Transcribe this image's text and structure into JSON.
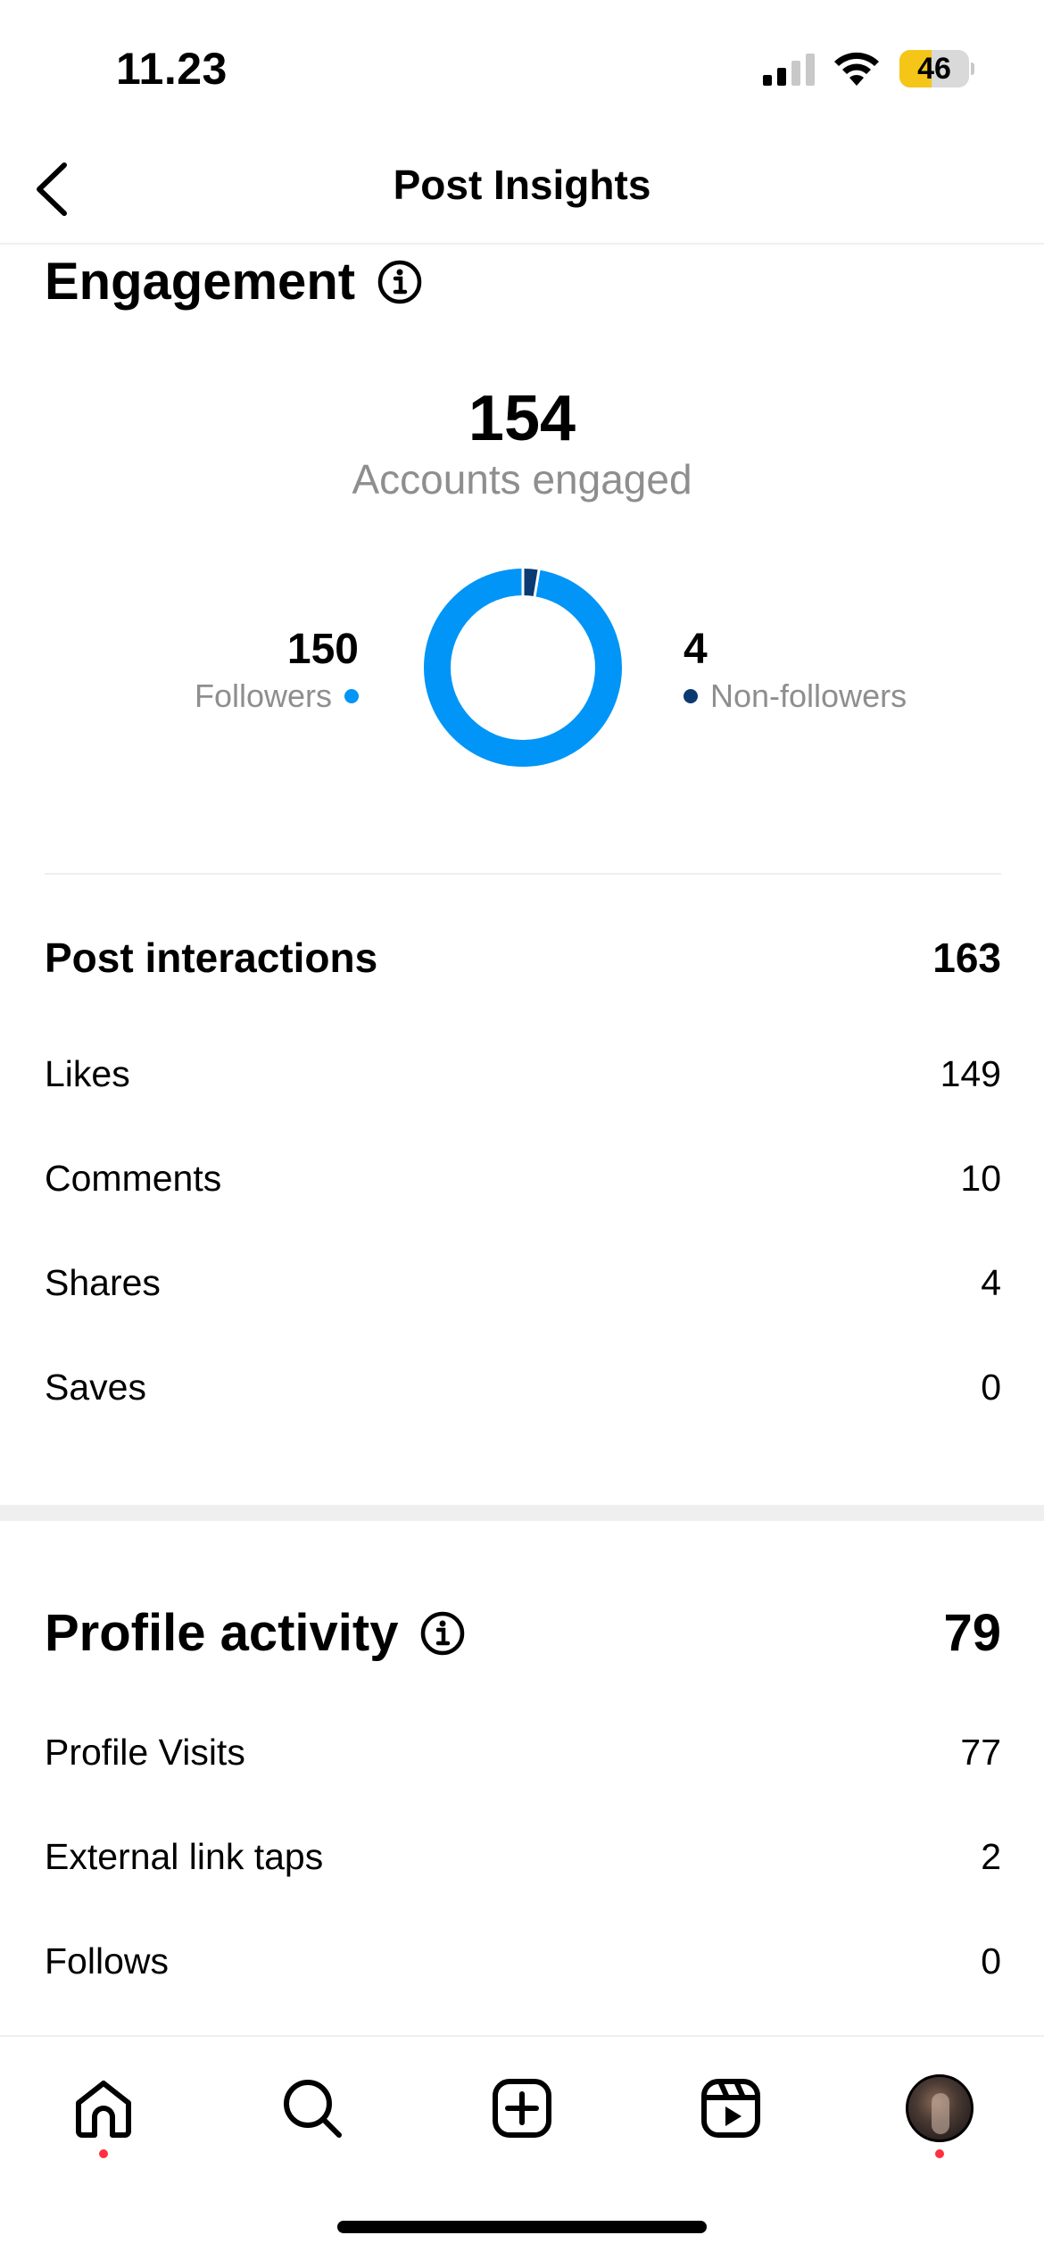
{
  "status_bar": {
    "time": "11.23",
    "battery_level": 46,
    "battery_text": "46",
    "battery_color": "#f5c518"
  },
  "header": {
    "back_icon": "chevron-left-icon",
    "title": "Post Insights"
  },
  "engagement": {
    "title": "Engagement",
    "info_icon": "info-icon",
    "accounts_engaged_value": "154",
    "accounts_engaged_label": "Accounts engaged",
    "followers_value": "150",
    "followers_label": "Followers",
    "non_followers_value": "4",
    "non_followers_label": "Non-followers",
    "followers_color": "#0095f6",
    "non_followers_color": "#0b3a73"
  },
  "post_interactions": {
    "title": "Post interactions",
    "total": "163",
    "rows": [
      {
        "label": "Likes",
        "value": "149"
      },
      {
        "label": "Comments",
        "value": "10"
      },
      {
        "label": "Shares",
        "value": "4"
      },
      {
        "label": "Saves",
        "value": "0"
      }
    ]
  },
  "profile_activity": {
    "title": "Profile activity",
    "info_icon": "info-icon",
    "total": "79",
    "rows": [
      {
        "label": "Profile Visits",
        "value": "77"
      },
      {
        "label": "External link taps",
        "value": "2"
      },
      {
        "label": "Follows",
        "value": "0"
      }
    ]
  },
  "tab_bar": {
    "tabs": [
      {
        "icon": "home-icon",
        "has_dot": true
      },
      {
        "icon": "search-icon",
        "has_dot": false
      },
      {
        "icon": "create-post-icon",
        "has_dot": false
      },
      {
        "icon": "reels-icon",
        "has_dot": false
      },
      {
        "icon": "profile-avatar",
        "has_dot": true
      }
    ],
    "notification_color": "#ff3040"
  }
}
